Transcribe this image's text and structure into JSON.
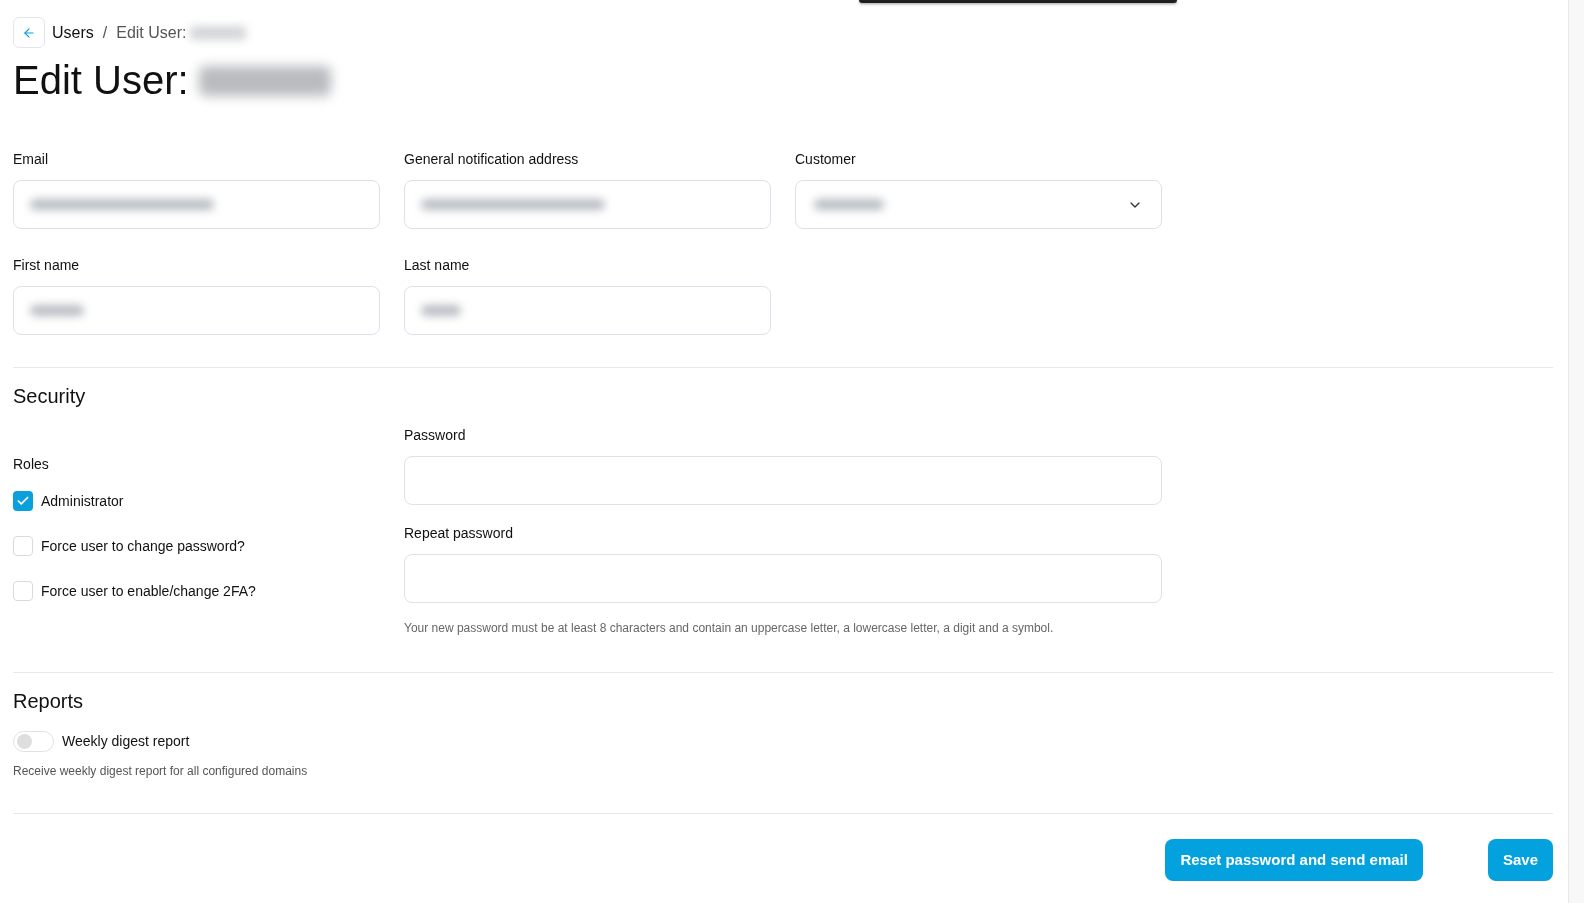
{
  "breadcrumb": {
    "items": [
      {
        "label": "Users"
      },
      {
        "label": "Edit User:",
        "redacted": true
      }
    ],
    "separator": "/"
  },
  "title": {
    "text": "Edit User:",
    "redacted": true
  },
  "fields": [
    {
      "kind": "text",
      "label": "Email",
      "redacted": true
    },
    {
      "kind": "text",
      "label": "General notification address",
      "redacted": true
    },
    {
      "kind": "select",
      "label": "Customer",
      "redacted": true
    },
    {
      "kind": "text",
      "label": "First name",
      "redacted": true
    },
    {
      "kind": "text",
      "label": "Last name",
      "redacted": true
    }
  ],
  "security": {
    "heading": "Security",
    "roles_label": "Roles",
    "options": [
      {
        "label": "Administrator",
        "checked": true
      },
      {
        "label": "Force user to change password?",
        "checked": false
      },
      {
        "label": "Force user to enable/change 2FA?",
        "checked": false
      }
    ],
    "password_fields": [
      {
        "label": "Password"
      },
      {
        "label": "Repeat password"
      }
    ],
    "hint": "Your new password must be at least 8 characters and contain an uppercase letter, a lowercase letter, a digit and a symbol."
  },
  "reports": {
    "heading": "Reports",
    "toggles": [
      {
        "label": "Weekly digest report",
        "on": false,
        "description": "Receive weekly digest report for all configured domains"
      }
    ]
  },
  "actions": [
    {
      "label": "Reset password and send email"
    },
    {
      "label": "Save"
    }
  ]
}
